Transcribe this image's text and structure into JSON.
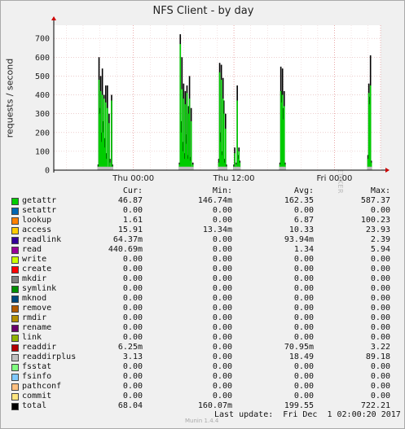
{
  "window": {
    "title": "NFS Client - by day"
  },
  "watermark": "RRDTOOL / TOBI OETIKER",
  "footer": {
    "version": "Munin 1.4.4",
    "last_update": "Last update:  Fri Dec  1 02:00:20 2017"
  },
  "legend": {
    "headers": [
      "Cur:",
      "Min:",
      "Avg:",
      "Max:"
    ],
    "items": [
      {
        "name": "getattr",
        "color": "#00cc00",
        "cur": "46.87",
        "min": "146.74m",
        "avg": "162.35",
        "max": "587.37"
      },
      {
        "name": "setattr",
        "color": "#0066b3",
        "cur": "0.00",
        "min": "0.00",
        "avg": "0.00",
        "max": "0.00"
      },
      {
        "name": "lookup",
        "color": "#ff8000",
        "cur": "1.61",
        "min": "0.00",
        "avg": "6.87",
        "max": "100.23"
      },
      {
        "name": "access",
        "color": "#ffcc00",
        "cur": "15.91",
        "min": "13.34m",
        "avg": "10.33",
        "max": "23.93"
      },
      {
        "name": "readlink",
        "color": "#330099",
        "cur": "64.37m",
        "min": "0.00",
        "avg": "93.94m",
        "max": "2.39"
      },
      {
        "name": "read",
        "color": "#990099",
        "cur": "440.69m",
        "min": "0.00",
        "avg": "1.34",
        "max": "5.94"
      },
      {
        "name": "write",
        "color": "#ccff00",
        "cur": "0.00",
        "min": "0.00",
        "avg": "0.00",
        "max": "0.00"
      },
      {
        "name": "create",
        "color": "#ff0000",
        "cur": "0.00",
        "min": "0.00",
        "avg": "0.00",
        "max": "0.00"
      },
      {
        "name": "mkdir",
        "color": "#808080",
        "cur": "0.00",
        "min": "0.00",
        "avg": "0.00",
        "max": "0.00"
      },
      {
        "name": "symlink",
        "color": "#008f00",
        "cur": "0.00",
        "min": "0.00",
        "avg": "0.00",
        "max": "0.00"
      },
      {
        "name": "mknod",
        "color": "#00487d",
        "cur": "0.00",
        "min": "0.00",
        "avg": "0.00",
        "max": "0.00"
      },
      {
        "name": "remove",
        "color": "#b35a00",
        "cur": "0.00",
        "min": "0.00",
        "avg": "0.00",
        "max": "0.00"
      },
      {
        "name": "rmdir",
        "color": "#b38f00",
        "cur": "0.00",
        "min": "0.00",
        "avg": "0.00",
        "max": "0.00"
      },
      {
        "name": "rename",
        "color": "#6b006b",
        "cur": "0.00",
        "min": "0.00",
        "avg": "0.00",
        "max": "0.00"
      },
      {
        "name": "link",
        "color": "#8fb300",
        "cur": "0.00",
        "min": "0.00",
        "avg": "0.00",
        "max": "0.00"
      },
      {
        "name": "readdir",
        "color": "#b30000",
        "cur": "6.25m",
        "min": "0.00",
        "avg": "70.95m",
        "max": "3.22"
      },
      {
        "name": "readdirplus",
        "color": "#bebebe",
        "cur": "3.13",
        "min": "0.00",
        "avg": "18.49",
        "max": "89.18"
      },
      {
        "name": "fsstat",
        "color": "#80ff80",
        "cur": "0.00",
        "min": "0.00",
        "avg": "0.00",
        "max": "0.00"
      },
      {
        "name": "fsinfo",
        "color": "#80c9ff",
        "cur": "0.00",
        "min": "0.00",
        "avg": "0.00",
        "max": "0.00"
      },
      {
        "name": "pathconf",
        "color": "#ffc080",
        "cur": "0.00",
        "min": "0.00",
        "avg": "0.00",
        "max": "0.00"
      },
      {
        "name": "commit",
        "color": "#ffe680",
        "cur": "0.00",
        "min": "0.00",
        "avg": "0.00",
        "max": "0.00"
      },
      {
        "name": "total",
        "color": "#000000",
        "cur": "68.04",
        "min": "160.07m",
        "avg": "199.55",
        "max": "722.21"
      }
    ]
  },
  "chart_data": {
    "type": "area",
    "title": "NFS Client - by day",
    "ylabel": "requests / second",
    "xlabel": "",
    "ylim": [
      0,
      770
    ],
    "yticks": [
      0,
      100,
      200,
      300,
      400,
      500,
      600,
      700
    ],
    "xlim_hours": [
      -9.5,
      29.5
    ],
    "xticks": [
      {
        "hours": 0,
        "label": "Thu 00:00"
      },
      {
        "hours": 12,
        "label": "Thu 12:00"
      },
      {
        "hours": 24,
        "label": "Fri 00:00"
      }
    ],
    "grid": true,
    "series": [
      {
        "name": "getattr",
        "color": "#00cc00",
        "points": [
          [
            -4.2,
            20
          ],
          [
            -4.1,
            480
          ],
          [
            -4.0,
            300
          ],
          [
            -3.9,
            420
          ],
          [
            -3.8,
            150
          ],
          [
            -3.7,
            400
          ],
          [
            -3.6,
            200
          ],
          [
            -3.5,
            380
          ],
          [
            -3.4,
            120
          ],
          [
            -3.3,
            360
          ],
          [
            -3.2,
            60
          ],
          [
            -3.1,
            330
          ],
          [
            -2.9,
            250
          ],
          [
            -2.8,
            40
          ],
          [
            -2.6,
            370
          ],
          [
            -2.5,
            20
          ],
          [
            5.5,
            30
          ],
          [
            5.6,
            670
          ],
          [
            5.7,
            200
          ],
          [
            5.8,
            430
          ],
          [
            5.9,
            100
          ],
          [
            6.0,
            380
          ],
          [
            6.1,
            60
          ],
          [
            6.2,
            350
          ],
          [
            6.3,
            140
          ],
          [
            6.4,
            410
          ],
          [
            6.5,
            60
          ],
          [
            6.6,
            300
          ],
          [
            6.7,
            380
          ],
          [
            6.8,
            50
          ],
          [
            6.9,
            260
          ],
          [
            7.1,
            30
          ],
          [
            10.2,
            40
          ],
          [
            10.3,
            520
          ],
          [
            10.4,
            150
          ],
          [
            10.5,
            480
          ],
          [
            10.6,
            80
          ],
          [
            10.7,
            380
          ],
          [
            10.8,
            300
          ],
          [
            10.9,
            40
          ],
          [
            11.0,
            220
          ],
          [
            11.1,
            20
          ],
          [
            12.0,
            20
          ],
          [
            12.1,
            90
          ],
          [
            12.3,
            30
          ],
          [
            12.4,
            370
          ],
          [
            12.5,
            60
          ],
          [
            12.6,
            100
          ],
          [
            12.7,
            40
          ],
          [
            17.5,
            30
          ],
          [
            17.6,
            420
          ],
          [
            17.7,
            360
          ],
          [
            17.8,
            400
          ],
          [
            17.9,
            270
          ],
          [
            18.0,
            340
          ],
          [
            18.1,
            30
          ],
          [
            28.0,
            60
          ],
          [
            28.1,
            410
          ],
          [
            28.2,
            350
          ],
          [
            28.3,
            450
          ],
          [
            28.4,
            40
          ]
        ]
      },
      {
        "name": "total",
        "color": "#000000",
        "points": [
          [
            -4.2,
            30
          ],
          [
            -4.1,
            600
          ],
          [
            -4.0,
            330
          ],
          [
            -3.9,
            500
          ],
          [
            -3.8,
            200
          ],
          [
            -3.7,
            540
          ],
          [
            -3.6,
            260
          ],
          [
            -3.5,
            400
          ],
          [
            -3.4,
            170
          ],
          [
            -3.3,
            450
          ],
          [
            -3.2,
            90
          ],
          [
            -3.1,
            450
          ],
          [
            -2.9,
            300
          ],
          [
            -2.8,
            60
          ],
          [
            -2.6,
            400
          ],
          [
            -2.5,
            30
          ],
          [
            5.5,
            40
          ],
          [
            5.6,
            722
          ],
          [
            5.7,
            260
          ],
          [
            5.8,
            600
          ],
          [
            5.9,
            150
          ],
          [
            6.0,
            460
          ],
          [
            6.1,
            90
          ],
          [
            6.2,
            420
          ],
          [
            6.3,
            190
          ],
          [
            6.4,
            450
          ],
          [
            6.5,
            80
          ],
          [
            6.6,
            340
          ],
          [
            6.7,
            500
          ],
          [
            6.8,
            70
          ],
          [
            6.9,
            330
          ],
          [
            7.1,
            40
          ],
          [
            10.2,
            60
          ],
          [
            10.3,
            570
          ],
          [
            10.4,
            200
          ],
          [
            10.5,
            560
          ],
          [
            10.6,
            100
          ],
          [
            10.7,
            490
          ],
          [
            10.8,
            370
          ],
          [
            10.9,
            60
          ],
          [
            11.0,
            300
          ],
          [
            11.1,
            30
          ],
          [
            12.0,
            30
          ],
          [
            12.1,
            120
          ],
          [
            12.3,
            40
          ],
          [
            12.4,
            450
          ],
          [
            12.5,
            80
          ],
          [
            12.6,
            120
          ],
          [
            12.7,
            50
          ],
          [
            17.5,
            40
          ],
          [
            17.6,
            550
          ],
          [
            17.7,
            420
          ],
          [
            17.8,
            540
          ],
          [
            17.9,
            330
          ],
          [
            18.0,
            420
          ],
          [
            18.1,
            40
          ],
          [
            28.0,
            80
          ],
          [
            28.1,
            460
          ],
          [
            28.2,
            390
          ],
          [
            28.3,
            610
          ],
          [
            28.4,
            50
          ]
        ]
      }
    ]
  }
}
